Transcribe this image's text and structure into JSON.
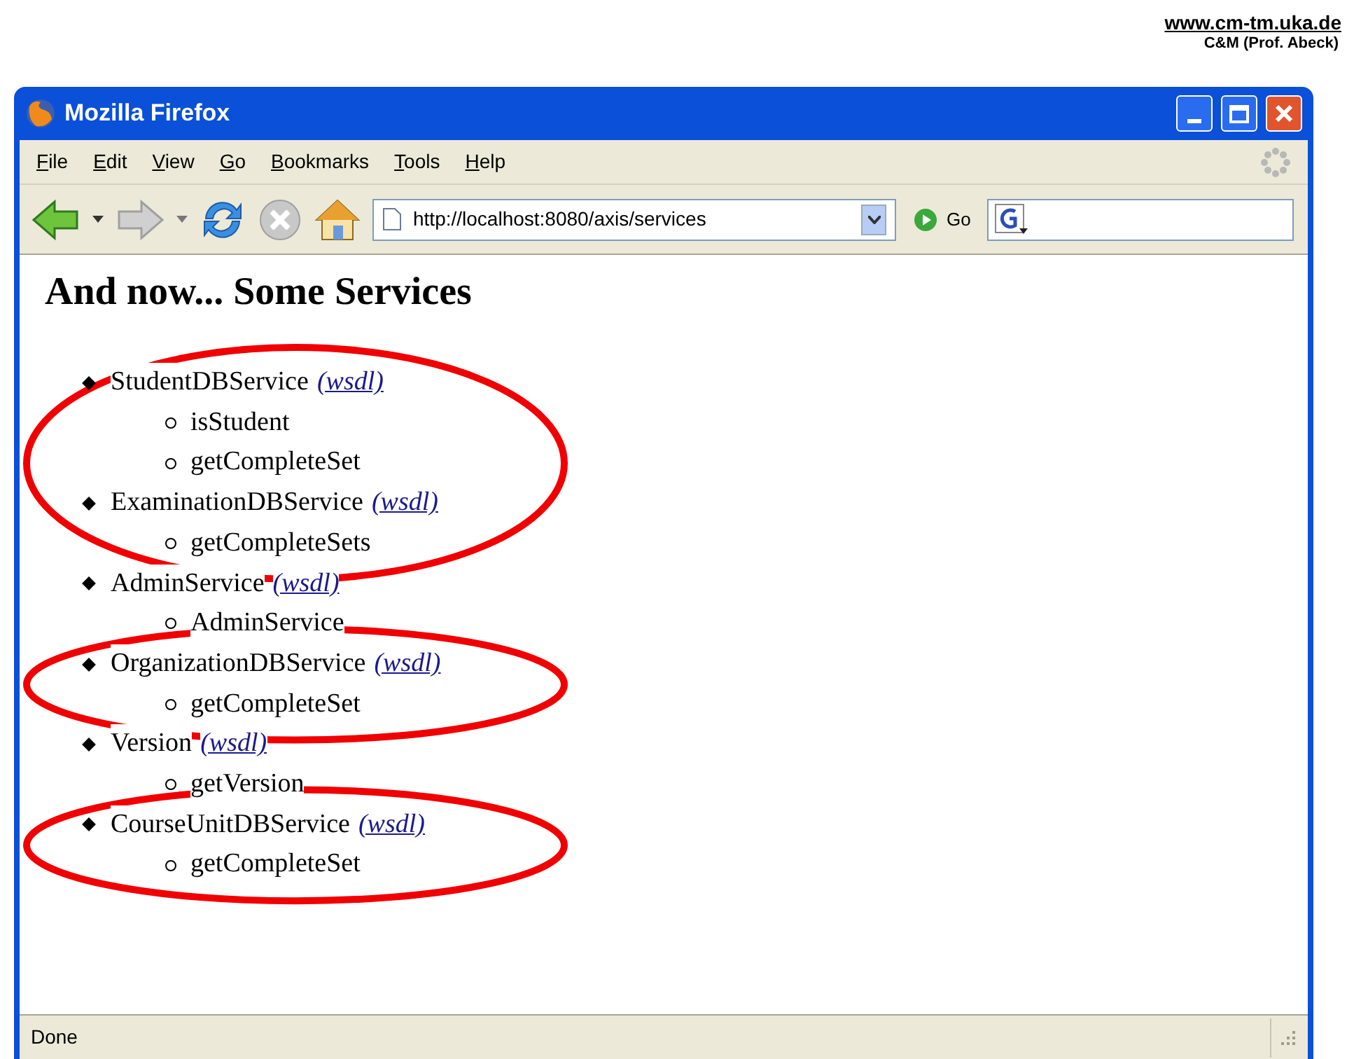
{
  "slide_header": {
    "link": "www.cm-tm.uka.de",
    "subtitle": "C&M (Prof. Abeck)"
  },
  "window": {
    "title": "Mozilla Firefox"
  },
  "menu": [
    "File",
    "Edit",
    "View",
    "Go",
    "Bookmarks",
    "Tools",
    "Help"
  ],
  "toolbar": {
    "url": "http://localhost:8080/axis/services",
    "go_label": "Go"
  },
  "page": {
    "heading": "And now... Some Services",
    "services": [
      {
        "name": "StudentDBService",
        "link": "(wsdl)",
        "circled": true,
        "methods": [
          "isStudent",
          "getCompleteSet"
        ]
      },
      {
        "name": "ExaminationDBService",
        "link": "(wsdl)",
        "circled": true,
        "methods": [
          "getCompleteSets"
        ]
      },
      {
        "name": "AdminService",
        "link": "(wsdl)",
        "circled": false,
        "methods": [
          "AdminService"
        ]
      },
      {
        "name": "OrganizationDBService",
        "link": "(wsdl)",
        "circled": true,
        "methods": [
          "getCompleteSet"
        ]
      },
      {
        "name": "Version",
        "link": "(wsdl)",
        "circled": false,
        "methods": [
          "getVersion"
        ]
      },
      {
        "name": "CourseUnitDBService",
        "link": "(wsdl)",
        "circled": true,
        "methods": [
          "getCompleteSet"
        ]
      }
    ]
  },
  "status_bar": "Done"
}
